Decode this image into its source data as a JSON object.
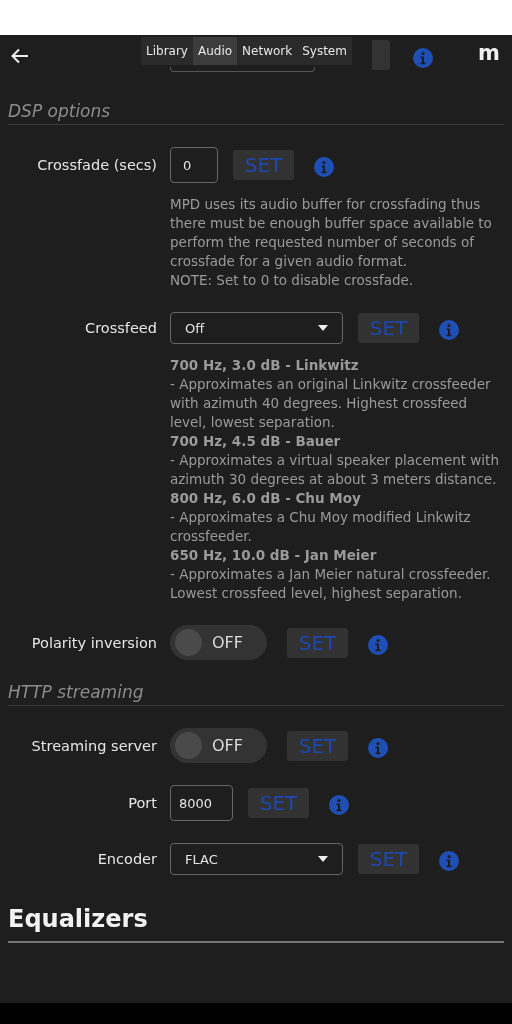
{
  "header": {
    "logo": "m"
  },
  "tabs": [
    {
      "label": "Library",
      "selected": false
    },
    {
      "label": "Audio",
      "selected": true
    },
    {
      "label": "Network",
      "selected": false
    },
    {
      "label": "System",
      "selected": false
    }
  ],
  "sections": [
    {
      "kind": "subheading",
      "title": "DSP options",
      "settings": [
        {
          "kind": "input",
          "label": "Crossfade (secs)",
          "value": "0",
          "button": "SET",
          "help": [
            {
              "text": "MPD uses its audio buffer for crossfading thus there must be enough buffer space available to perform the requested number of seconds of crossfade for a given audio format.",
              "bold": false
            },
            {
              "text": "NOTE: Set to 0 to disable crossfade.",
              "bold": false
            }
          ]
        },
        {
          "kind": "select",
          "label": "Crossfeed",
          "value": "Off",
          "button": "SET",
          "help": [
            {
              "text": "700 Hz, 3.0 dB - Linkwitz",
              "bold": true
            },
            {
              "text": "- Approximates an original Linkwitz crossfeeder with azimuth 40 degrees. Highest crossfeed level, lowest separation.",
              "bold": false
            },
            {
              "text": "700 Hz, 4.5 dB - Bauer",
              "bold": true
            },
            {
              "text": "- Approximates a virtual speaker placement with azimuth 30 degrees at about 3 meters distance.",
              "bold": false
            },
            {
              "text": "800 Hz, 6.0 dB - Chu Moy",
              "bold": true
            },
            {
              "text": "- Approximates a Chu Moy modified Linkwitz crossfeeder.",
              "bold": false
            },
            {
              "text": "650 Hz, 10.0 dB - Jan Meier",
              "bold": true
            },
            {
              "text": "- Approximates a Jan Meier natural crossfeeder. Lowest crossfeed level, highest separation.",
              "bold": false
            }
          ]
        },
        {
          "kind": "toggle",
          "label": "Polarity inversion",
          "on": false,
          "value": "OFF",
          "button": "SET"
        }
      ]
    },
    {
      "kind": "subheading",
      "title": "HTTP streaming",
      "settings": [
        {
          "kind": "toggle",
          "label": "Streaming server",
          "on": false,
          "value": "OFF",
          "button": "SET"
        },
        {
          "kind": "input",
          "label": "Port",
          "value": "8000",
          "button": "SET"
        },
        {
          "kind": "select",
          "label": "Encoder",
          "value": "FLAC",
          "button": "SET"
        }
      ]
    },
    {
      "kind": "heading",
      "title": "Equalizers"
    }
  ]
}
